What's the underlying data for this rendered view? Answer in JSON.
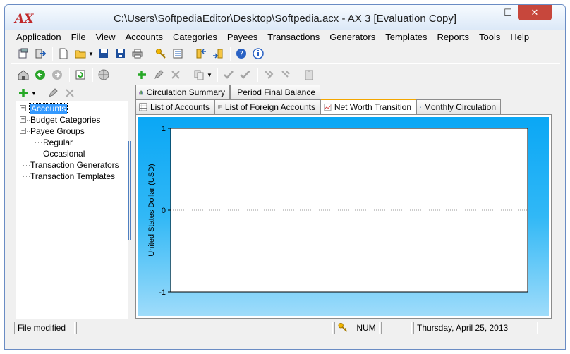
{
  "window": {
    "title": "C:\\Users\\SoftpediaEditor\\Desktop\\Softpedia.acx - AX 3 [Evaluation Copy]",
    "logo": "AX",
    "minimize": "—",
    "maximize": "☐",
    "close": "✕"
  },
  "menu": [
    "Application",
    "File",
    "View",
    "Accounts",
    "Categories",
    "Payees",
    "Transactions",
    "Generators",
    "Templates",
    "Reports",
    "Tools",
    "Help"
  ],
  "tree": {
    "items": [
      {
        "label": "Accounts"
      },
      {
        "label": "Budget Categories"
      },
      {
        "label": "Payee Groups"
      },
      {
        "label": "Regular"
      },
      {
        "label": "Occasional"
      },
      {
        "label": "Transaction Generators"
      },
      {
        "label": "Transaction Templates"
      }
    ]
  },
  "tabs": {
    "row1": [
      {
        "label": "Circulation Summary"
      },
      {
        "label": "Period Final Balance"
      }
    ],
    "row2": [
      {
        "label": "List of Accounts"
      },
      {
        "label": "List of Foreign Accounts"
      },
      {
        "label": "Net Worth Transition"
      },
      {
        "label": "Monthly Circulation"
      }
    ]
  },
  "chart_data": {
    "type": "line",
    "title": "",
    "xlabel": "",
    "ylabel": "United States Dollar (USD)",
    "ylim": [
      -1,
      1
    ],
    "yticks": [
      "1",
      "0",
      "-1"
    ],
    "series": [],
    "grid": true,
    "colors": {
      "background_top": "#0aa7f5",
      "background_bottom": "#9fdcfa",
      "plot": "#ffffff"
    }
  },
  "status": {
    "message": "File modified",
    "num": "NUM",
    "date": "Thursday, April 25, 2013"
  }
}
